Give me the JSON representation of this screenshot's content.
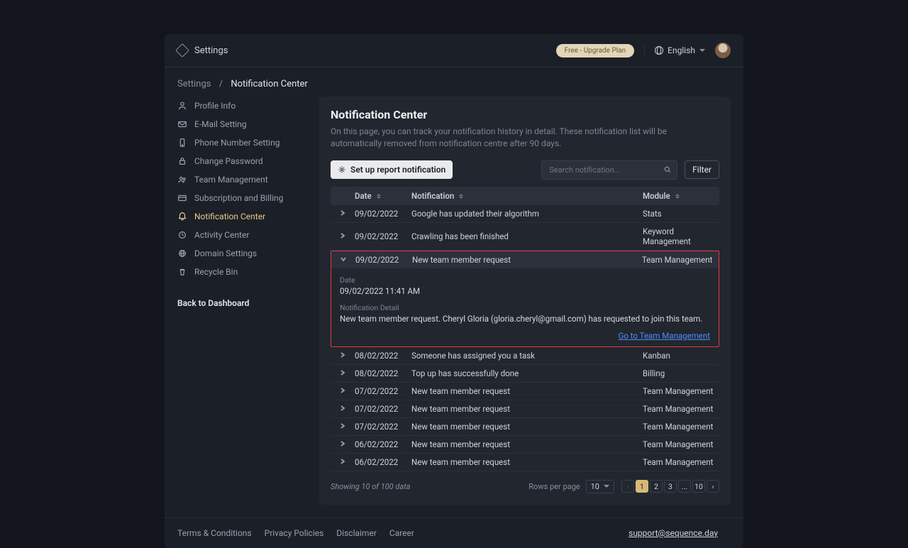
{
  "topbar": {
    "title": "Settings",
    "upgrade": "Free - Upgrade Plan",
    "language": "English"
  },
  "breadcrumb": {
    "root": "Settings",
    "sep": "/",
    "current": "Notification Center"
  },
  "sidebar": {
    "items": [
      {
        "icon": "user-icon",
        "label": "Profile Info"
      },
      {
        "icon": "mail-icon",
        "label": "E-Mail Setting"
      },
      {
        "icon": "phone-icon",
        "label": "Phone Number Setting"
      },
      {
        "icon": "lock-icon",
        "label": "Change Password"
      },
      {
        "icon": "users-icon",
        "label": "Team Management"
      },
      {
        "icon": "card-icon",
        "label": "Subscription and Billing"
      },
      {
        "icon": "bell-icon",
        "label": "Notification Center"
      },
      {
        "icon": "clock-icon",
        "label": "Activity Center"
      },
      {
        "icon": "globe-icon",
        "label": "Domain Settings"
      },
      {
        "icon": "trash-icon",
        "label": "Recycle Bin"
      }
    ],
    "back": "Back to Dashboard"
  },
  "main": {
    "title": "Notification Center",
    "subtitle": "On this page, you can track your notification history in detail. These notification list will be automatically removed from notification centre after 90 days.",
    "setup_label": "Set up report notification",
    "search_placeholder": "Search notification...",
    "filter_label": "Filter",
    "columns": {
      "date": "Date",
      "notification": "Notification",
      "module": "Module"
    },
    "rows": [
      {
        "date": "09/02/2022",
        "notif": "Google has updated their algorithm",
        "module": "Stats"
      },
      {
        "date": "09/02/2022",
        "notif": "Crawling has been finished",
        "module": "Keyword Management"
      },
      {
        "date": "09/02/2022",
        "notif": "New team member request",
        "module": "Team Management"
      },
      {
        "date": "08/02/2022",
        "notif": "Someone has assigned you a task",
        "module": "Kanban"
      },
      {
        "date": "08/02/2022",
        "notif": "Top up has successfully done",
        "module": "Billing"
      },
      {
        "date": "07/02/2022",
        "notif": "New team member request",
        "module": "Team Management"
      },
      {
        "date": "07/02/2022",
        "notif": "New team member request",
        "module": "Team Management"
      },
      {
        "date": "07/02/2022",
        "notif": "New team member request",
        "module": "Team Management"
      },
      {
        "date": "06/02/2022",
        "notif": "New team member request",
        "module": "Team Management"
      },
      {
        "date": "06/02/2022",
        "notif": "New team member request",
        "module": "Team Management"
      }
    ],
    "expanded": {
      "date_label": "Date",
      "date_value": "09/02/2022 11:41 AM",
      "detail_label": "Notification Detail",
      "detail_value": "New team member request. Cheryl Gloria (gloria.cheryl@gmail.com) has requested to join this team.",
      "link_label": "Go to Team Management"
    },
    "footer": {
      "showing": "Showing 10 of 100 data",
      "rows_per_page_label": "Rows per page",
      "rows_per_page_value": "10",
      "pages": [
        "1",
        "2",
        "3",
        "...",
        "10"
      ]
    }
  },
  "footer": {
    "links": [
      "Terms & Conditions",
      "Privacy Policies",
      "Disclaimer",
      "Career"
    ],
    "support": "support@sequence.day"
  }
}
